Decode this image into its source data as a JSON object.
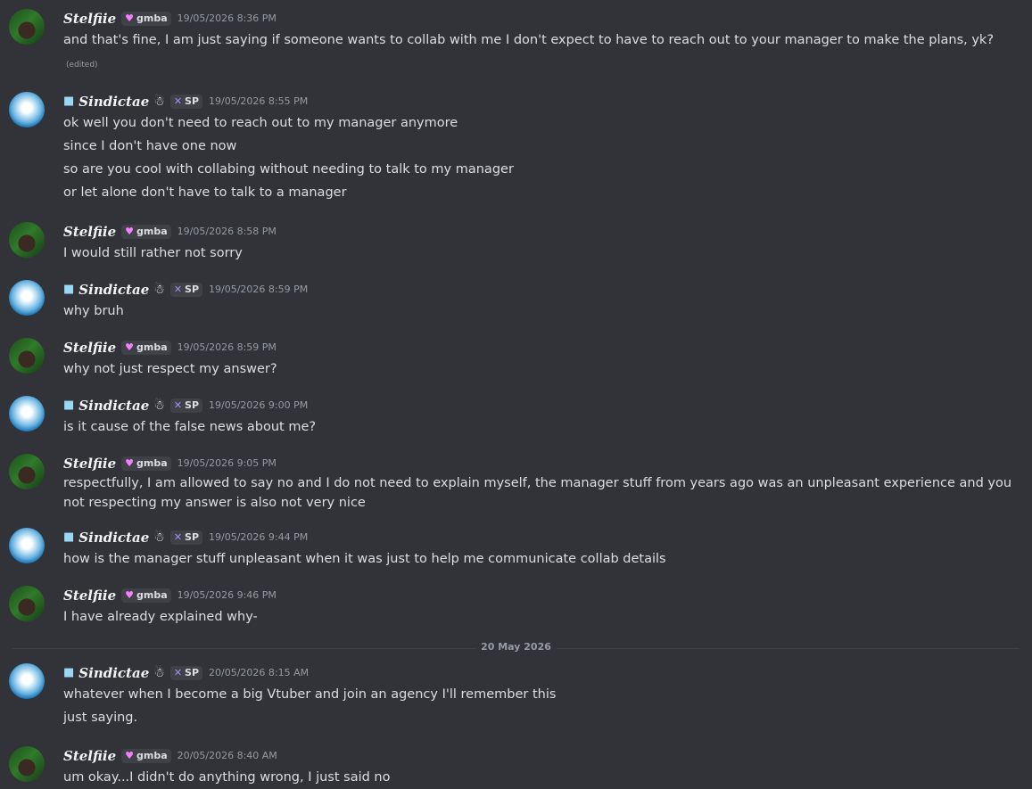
{
  "users": {
    "stelfiie": {
      "name": "Stelfiie",
      "tag": "gmba"
    },
    "sindictae": {
      "name": "Sindictae",
      "tag": "SP"
    }
  },
  "messages": [
    {
      "time": "19/05/2026 8:36 PM",
      "lines": [
        "and that's fine, I am just saying if someone wants to collab with me I don't expect to have to reach out to your manager to make the plans, yk?"
      ],
      "edited": "(edited)"
    },
    {
      "time": "19/05/2026 8:55 PM",
      "lines": [
        "ok well you don't need to reach out to my manager anymore",
        "since I don't have one now",
        "so are you cool with collabing without needing to talk to my manager",
        "or let alone don't have to talk to a manager"
      ]
    },
    {
      "time": "19/05/2026 8:58 PM",
      "lines": [
        "I would still rather not sorry"
      ]
    },
    {
      "time": "19/05/2026 8:59 PM",
      "lines": [
        "why bruh"
      ]
    },
    {
      "time": "19/05/2026 8:59 PM",
      "lines": [
        "why not just respect my answer?"
      ]
    },
    {
      "time": "19/05/2026 9:00 PM",
      "lines": [
        "is it cause of the false news about me?"
      ]
    },
    {
      "time": "19/05/2026 9:05 PM",
      "lines": [
        "respectfully, I am allowed to say no and I do not need to explain myself, the manager stuff from years ago was an unpleasant experience and you not respecting my answer is also not very nice"
      ]
    },
    {
      "time": "19/05/2026 9:44 PM",
      "lines": [
        "how is the manager stuff unpleasant when it was just to help me communicate collab details"
      ]
    },
    {
      "time": "19/05/2026 9:46 PM",
      "lines": [
        "I have already explained why-"
      ]
    },
    {
      "time": "20/05/2026 8:15 AM",
      "lines": [
        "whatever when I become a big Vtuber and join an agency I'll remember this",
        "just saying."
      ]
    },
    {
      "time": "20/05/2026 8:40 AM",
      "lines": [
        "um okay...I didn't do anything wrong, I just said no"
      ]
    }
  ],
  "date_divider": "20 May 2026",
  "icons": {
    "stelfiie_tag_icon": "heart-icon",
    "sindictae_tag_icon": "x-pattern-icon",
    "sindictae_prefix_icon": "ice-cube-icon",
    "sindictae_suffix_icon": "ghost-icon"
  },
  "colors": {
    "background": "#313338",
    "text": "#dbdee1",
    "muted": "#949ba4",
    "username": "#f2f3f5"
  }
}
